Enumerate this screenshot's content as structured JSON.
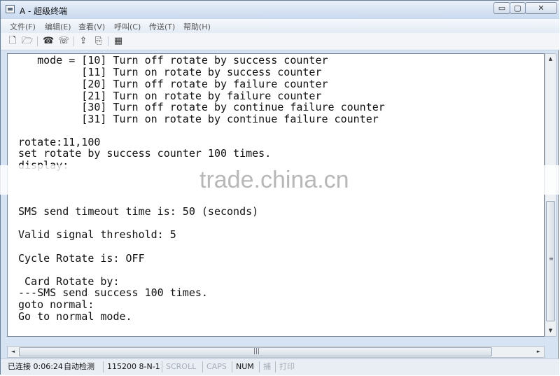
{
  "window": {
    "title": "A - 超级终端",
    "buttons": {
      "minimize": "▭",
      "maximize": "▢",
      "close": "✕"
    }
  },
  "menu": [
    "文件(F)",
    "编辑(E)",
    "查看(V)",
    "呼叫(C)",
    "传送(T)",
    "帮助(H)"
  ],
  "toolbar": {
    "icons": [
      "new-icon",
      "open-icon",
      "phone-connect-icon",
      "phone-disconnect-icon",
      "send-file-icon",
      "receive-file-icon",
      "properties-icon"
    ],
    "glyphs": [
      "🗋",
      "🗁",
      "☎",
      "☏",
      "⇪",
      "⎘",
      "▦"
    ]
  },
  "terminal": {
    "lines": [
      "   mode = [10] Turn off rotate by success counter",
      "          [11] Turn on rotate by success counter",
      "          [20] Turn off rotate by failure counter",
      "          [21] Turn on rotate by failure counter",
      "          [30] Turn off rotate by continue failure counter",
      "          [31] Turn on rotate by continue failure counter",
      "",
      "rotate:11,100",
      "set rotate by success counter 100 times.",
      "display:",
      "",
      "",
      "",
      "SMS send timeout time is: 50 (seconds)",
      "",
      "Valid signal threshold: 5",
      "",
      "Cycle Rotate is: OFF",
      "",
      " Card Rotate by:",
      "---SMS send success 100 times.",
      "goto normal:",
      "Go to normal mode."
    ]
  },
  "scrollbar": {
    "up": "▲",
    "down": "▼",
    "left": "◄",
    "right": "►",
    "grip": "≡",
    "hgrip": "|||"
  },
  "status": {
    "connection": "已连接 0:06:24",
    "detect": "自动检测",
    "baud": "115200 8-N-1",
    "scroll": "SCROLL",
    "caps": "CAPS",
    "num": "NUM",
    "capture": "捕",
    "print": "打印"
  },
  "watermark": "trade.china.cn"
}
